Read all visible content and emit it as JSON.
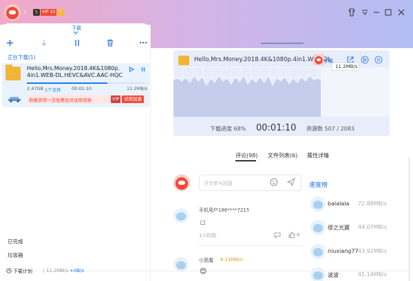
{
  "header": {
    "vip_number": "5",
    "vip_label": "VIP 10",
    "trial_badge": "T"
  },
  "left_panel": {
    "tab_label": "下载",
    "downloading_header": "正在下载(1)",
    "task": {
      "name": "Hello,Mrs.Money.2018.4K&1080p.4in1.WEB-DL.HEVC&AVC.AAC-HQC",
      "size": "2.47GB",
      "file_count": "1个文件",
      "time": "00:01:10",
      "speed": "11.2MB/s",
      "promo_text": "恭喜获得一次免费会员试用资格",
      "vip_tag": "VIP",
      "trial_button": "试用加速",
      "progress": 0.68
    },
    "completed": "已完成",
    "trash": "垃圾箱",
    "footer_plan": "下载计划",
    "footer_speed": "11.2MB/s",
    "footer_upload": "+0B/s"
  },
  "detail": {
    "title": "Hello,Mrs.Money.2018.4K&1080p.4in1.WEB-DL",
    "subtitle_btn": "字幕",
    "speed_tip": "11.2MB/s",
    "progress_text": "下载进度 68%",
    "elapsed": "00:01:10",
    "resources": "资源数 507 / 2083"
  },
  "tabs": {
    "comments": "评论(98)",
    "files": "文件列表(6)",
    "attributes": "属性详情"
  },
  "comment_input": {
    "placeholder": "评论参与回复"
  },
  "comments": [
    {
      "user": "手机用户186****7215",
      "text": "□",
      "time": "1小时前"
    },
    {
      "user": "小恶魔",
      "speed": "6.11MB/s",
      "emoji": "😊"
    }
  ],
  "ranking": {
    "title": "速度榜",
    "items": [
      {
        "name": "balalala",
        "speed": "72.88MB/s"
      },
      {
        "name": "缪之光翼",
        "speed": "44.07MB/s"
      },
      {
        "name": "niuxiang77",
        "speed": "43.92MB/s"
      },
      {
        "name": "波波",
        "speed": "41.14MB/s"
      }
    ]
  },
  "colors": {
    "accent": "#1e74e8",
    "promo": "#f04a3a",
    "chart_fill": "#bfc9ea"
  }
}
